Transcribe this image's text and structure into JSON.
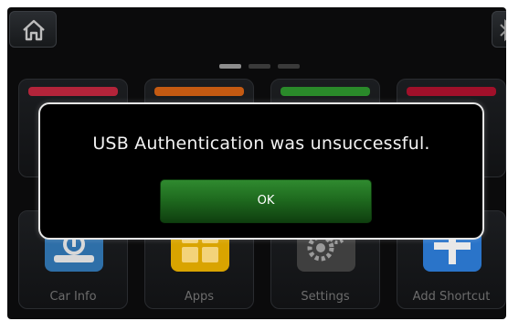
{
  "dialog": {
    "message": "USB Authentication was unsuccessful.",
    "ok_label": "OK"
  },
  "home_grid": {
    "page_count": 3,
    "active_page": 1,
    "bottom_row": [
      {
        "label": "Car Info",
        "icon": "car-info-icon",
        "color": "#2e6fa8"
      },
      {
        "label": "Apps",
        "icon": "apps-grid-icon",
        "color": "#d9a400"
      },
      {
        "label": "Settings",
        "icon": "gears-icon",
        "color": "#4a4a4a"
      },
      {
        "label": "Add Shortcut",
        "icon": "plus-icon",
        "color": "#2a74c9"
      }
    ],
    "top_row_colors": [
      "#b3243a",
      "#c45a12",
      "#2a8a2a",
      "#a0102a"
    ]
  },
  "top_bar": {
    "home_icon": "home-icon",
    "bluetooth_icon": "bluetooth-icon"
  }
}
